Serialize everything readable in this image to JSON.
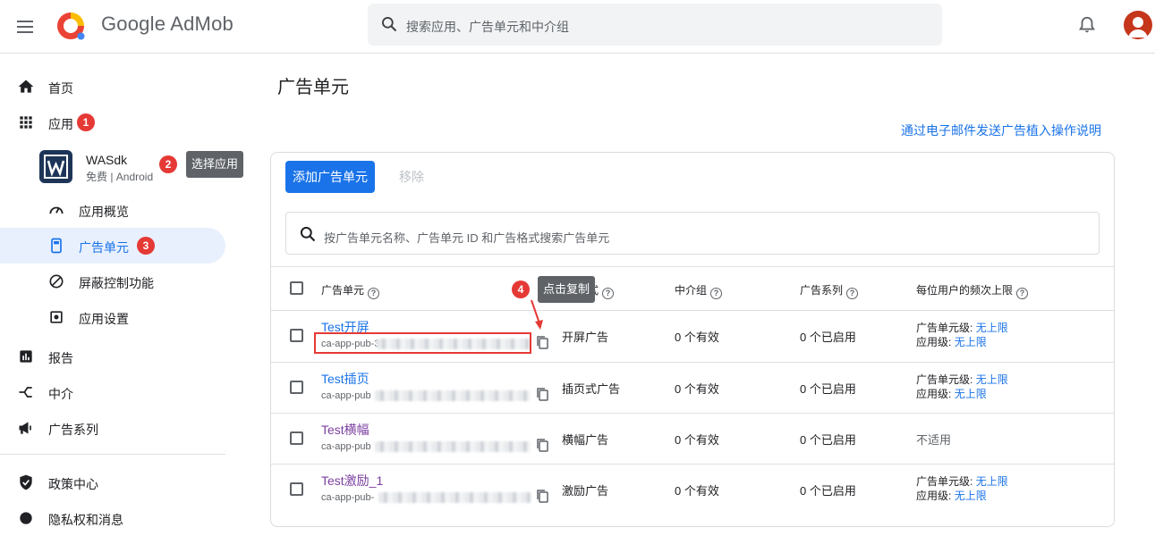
{
  "header": {
    "brand": "Google AdMob",
    "search_placeholder": "搜索应用、广告单元和中介组"
  },
  "sidebar": {
    "home": "首页",
    "apps": "应用",
    "apps_badge": "1",
    "app": {
      "name": "WASdk",
      "meta": "免费 | Android",
      "badge": "2",
      "tooltip": "选择应用"
    },
    "overview": "应用概览",
    "ad_units": "广告单元",
    "ad_units_badge": "3",
    "blocking": "屏蔽控制功能",
    "settings": "应用设置",
    "reports": "报告",
    "mediation": "中介",
    "campaigns": "广告系列",
    "policy": "政策中心",
    "privacy": "隐私权和消息"
  },
  "main": {
    "title": "广告单元",
    "email_link": "通过电子邮件发送广告植入操作说明",
    "add_button": "添加广告单元",
    "remove_button": "移除",
    "search_placeholder": "按广告单元名称、广告单元 ID 和广告格式搜索广告单元",
    "columns": {
      "ad_unit": "广告单元",
      "format": "格式",
      "mediation": "中介组",
      "campaigns": "广告系列",
      "frequency": "每位用户的频次上限"
    },
    "copy_tooltip": "点击复制",
    "copy_badge": "4",
    "rows": [
      {
        "name": "Test开屏",
        "id": "ca-app-pub-3",
        "format": "开屏广告",
        "mediation": "0 个有效",
        "campaigns": "0 个已启用",
        "freq_unit_label": "广告单元级:",
        "freq_unit_value": "无上限",
        "freq_app_label": "应用级:",
        "freq_app_value": "无上限"
      },
      {
        "name": "Test插页",
        "id": "ca-app-pub",
        "format": "插页式广告",
        "mediation": "0 个有效",
        "campaigns": "0 个已启用",
        "freq_unit_label": "广告单元级:",
        "freq_unit_value": "无上限",
        "freq_app_label": "应用级:",
        "freq_app_value": "无上限"
      },
      {
        "name": "Test横幅",
        "id": "ca-app-pub",
        "format": "横幅广告",
        "mediation": "0 个有效",
        "campaigns": "0 个已启用",
        "freq_na": "不适用"
      },
      {
        "name": "Test激励_1",
        "id": "ca-app-pub-",
        "format": "激励广告",
        "mediation": "0 个有效",
        "campaigns": "0 个已启用",
        "freq_unit_label": "广告单元级:",
        "freq_unit_value": "无上限",
        "freq_app_label": "应用级:",
        "freq_app_value": "无上限"
      }
    ]
  },
  "colors": {
    "accent": "#1a73e8",
    "badge": "#e53935",
    "active_bg": "#e8f0fe"
  }
}
